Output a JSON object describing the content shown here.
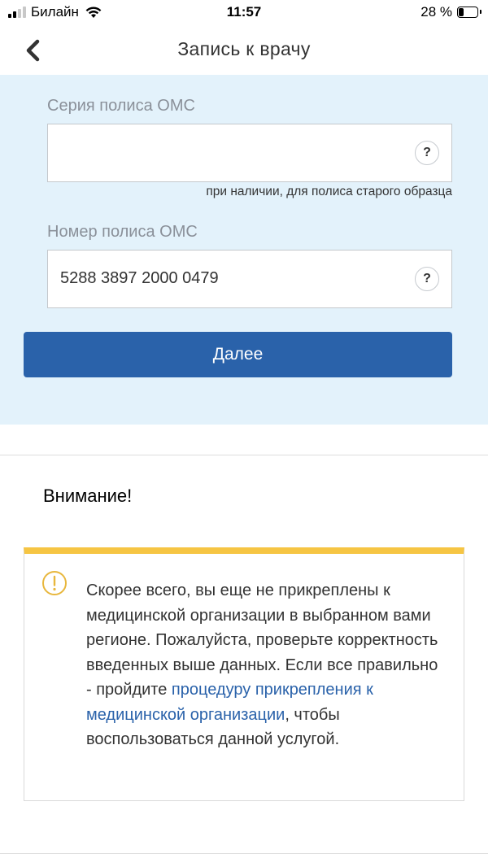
{
  "status_bar": {
    "carrier": "Билайн",
    "time": "11:57",
    "battery_text": "28 %",
    "battery_level": 0.28,
    "signal_bars": 2
  },
  "nav": {
    "title": "Запись к врачу",
    "back_icon": "chevron-left-icon"
  },
  "form": {
    "series_label": "Серия полиса ОМС",
    "series_value": "",
    "series_hint": "при наличии, для полиса старого образца",
    "number_label": "Номер полиса ОМС",
    "number_value": "5288 3897 2000 0479",
    "help_label": "?",
    "submit_label": "Далее"
  },
  "warning": {
    "title": "Внимание!",
    "icon": "exclamation-circle-icon",
    "text_before": "Скорее всего, вы еще не прикреплены к медицинской организации в выбранном вами регионе. Пожалуйста, проверьте корректность введенных выше данных. Если все правильно - пройдите ",
    "link_text": "процедуру прикрепления к медицинской организации",
    "text_after": ", чтобы воспользоваться данной услугой."
  },
  "colors": {
    "accent": "#2a62aa",
    "form_background": "#e3f2fb",
    "warning_stripe": "#f6c543",
    "warning_icon": "#e8b73d"
  }
}
